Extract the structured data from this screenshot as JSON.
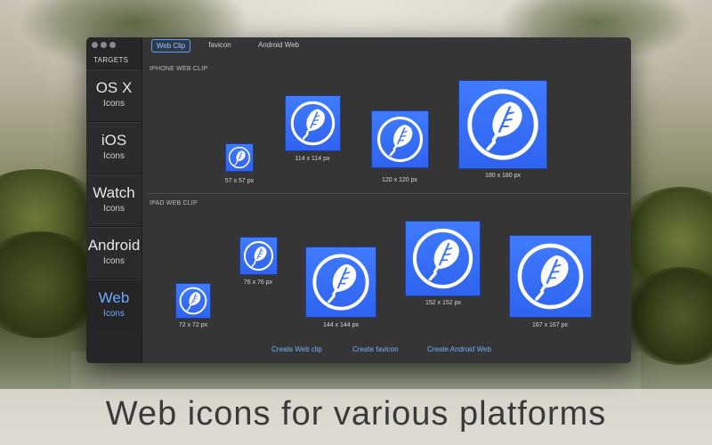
{
  "caption": "Web icons for various platforms",
  "sidebar": {
    "header": "TARGETS",
    "items": [
      {
        "title": "OS X",
        "subtitle": "Icons"
      },
      {
        "title": "iOS",
        "subtitle": "Icons"
      },
      {
        "title": "Watch",
        "subtitle": "Icons"
      },
      {
        "title": "Android",
        "subtitle": "Icons"
      },
      {
        "title": "Web",
        "subtitle": "Icons",
        "active": true
      }
    ]
  },
  "tabs": [
    "Web Clip",
    "favicon",
    "Android Web"
  ],
  "selected_tab": "Web Clip",
  "iphone": {
    "label": "IPHONE WEB CLIP",
    "icons": [
      "57 x 57 px",
      "114 x 114 px",
      "120 x 120 px",
      "180 x 180 px"
    ]
  },
  "ipad": {
    "label": "IPAD WEB CLIP",
    "icons": [
      "72 x 72 px",
      "76 x 76 px",
      "144 x 144 px",
      "152 x 152 px",
      "167 x 167 px"
    ]
  },
  "actions": [
    "Create Web clip",
    "Create favicon",
    "Create Android Web"
  ],
  "colors": {
    "accent": "#6ea8ff",
    "icon_blue": "#3a72ff",
    "window_bg": "#353535",
    "sidebar_bg": "#262626"
  },
  "icon_glyph": "feather-in-circle-icon"
}
